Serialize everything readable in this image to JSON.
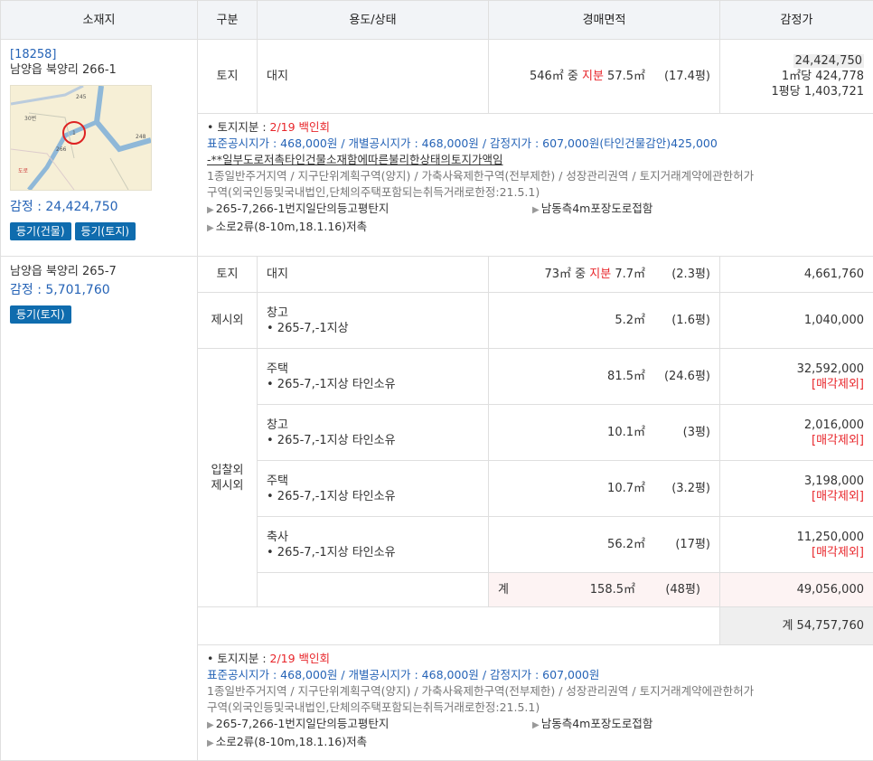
{
  "headers": {
    "location": "소재지",
    "type": "구분",
    "use": "용도/상태",
    "area": "경매면적",
    "appraisal": "감정가"
  },
  "colors": {
    "accent_blue": "#2563b6",
    "button_blue": "#0f6cae",
    "red": "#e8262b"
  },
  "buttons": {
    "reg_building": "등기(건물)",
    "reg_land": "등기(토지)"
  },
  "icons": {
    "bullet": "triangle-right-icon"
  },
  "lot1": {
    "zip": "[18258]",
    "address": "남양읍 북양리 266-1",
    "appraisal_label": "감정 : 24,424,750",
    "row": {
      "type": "토지",
      "use": "대지",
      "area_pre": "546㎡ 중 ",
      "area_share": "지분",
      "area_post": " 57.5㎡",
      "pyeong": "(17.4평)",
      "price": "24,424,750",
      "per_m2": "1㎡당 424,778",
      "per_py": "1평당 1,403,721"
    },
    "detail": {
      "share_label": "• 토지지분 : ",
      "share_value": "2/19 백인회",
      "price_line": "표준공시지가 : 468,000원 / 개별공시지가 : 468,000원 / 감정지가 : 607,000원(타인건물감안)425,000",
      "note": "-**일부도로저촉타인건물소재함에따른불리한상태의토지가액임",
      "zoning1": "1종일반주거지역 / 지구단위계획구역(양지) / 가축사육제한구역(전부제한) / 성장관리권역 / 토지거래계약에관한허가",
      "zoning2": "구역(외국인등및국내법인,단체의주택포함되는취득거래로한정:21.5.1)",
      "feat1": "265-7,266-1번지일단의등고평탄지",
      "feat2": "남동측4m포장도로접함",
      "feat3": "소로2류(8-10m,18.1.16)저촉"
    }
  },
  "lot2": {
    "address": "남양읍 북양리 265-7",
    "appraisal_label": "감정 : 5,701,760",
    "land": {
      "type": "토지",
      "use": "대지",
      "area_pre": "73㎡ 중 ",
      "area_share": "지분",
      "area_post": " 7.7㎡",
      "pyeong": "(2.3평)",
      "price": "4,661,760"
    },
    "excl": {
      "type": "제시외",
      "use": "창고",
      "sub": "• 265-7,-1지상",
      "area": "5.2㎡",
      "pyeong": "(1.6평)",
      "price": "1,040,000"
    },
    "bid_excl_type": "입찰외 제시외",
    "bid_excl_type_l1": "입찰외",
    "bid_excl_type_l2": "제시외",
    "items": [
      {
        "use": "주택",
        "sub": "• 265-7,-1지상 타인소유",
        "area": "81.5㎡",
        "pyeong": "(24.6평)",
        "price": "32,592,000",
        "note": "[매각제외]"
      },
      {
        "use": "창고",
        "sub": "• 265-7,-1지상 타인소유",
        "area": "10.1㎡",
        "pyeong": "(3평)",
        "price": "2,016,000",
        "note": "[매각제외]"
      },
      {
        "use": "주택",
        "sub": "• 265-7,-1지상 타인소유",
        "area": "10.7㎡",
        "pyeong": "(3.2평)",
        "price": "3,198,000",
        "note": "[매각제외]"
      },
      {
        "use": "축사",
        "sub": "• 265-7,-1지상 타인소유",
        "area": "56.2㎡",
        "pyeong": "(17평)",
        "price": "11,250,000",
        "note": "[매각제외]"
      }
    ],
    "subtotal": {
      "label": "계",
      "area": "158.5㎡",
      "pyeong": "(48평)",
      "price": "49,056,000"
    },
    "total": "계 54,757,760",
    "detail": {
      "share_label": "• 토지지분 : ",
      "share_value": "2/19 백인회",
      "price_line": "표준공시지가 : 468,000원 / 개별공시지가 : 468,000원 / 감정지가 : 607,000원",
      "zoning1": "1종일반주거지역 / 지구단위계획구역(양지) / 가축사육제한구역(전부제한) / 성장관리권역 / 토지거래계약에관한허가",
      "zoning2": "구역(외국인등및국내법인,단체의주택포함되는취득거래로한정:21.5.1)",
      "feat1": "265-7,266-1번지일단의등고평탄지",
      "feat2": "남동측4m포장도로접함",
      "feat3": "소로2류(8-10m,18.1.16)저촉"
    }
  },
  "map": {
    "labels": [
      "245",
      "30번",
      "1",
      "3",
      "266",
      "248",
      "4대"
    ]
  }
}
